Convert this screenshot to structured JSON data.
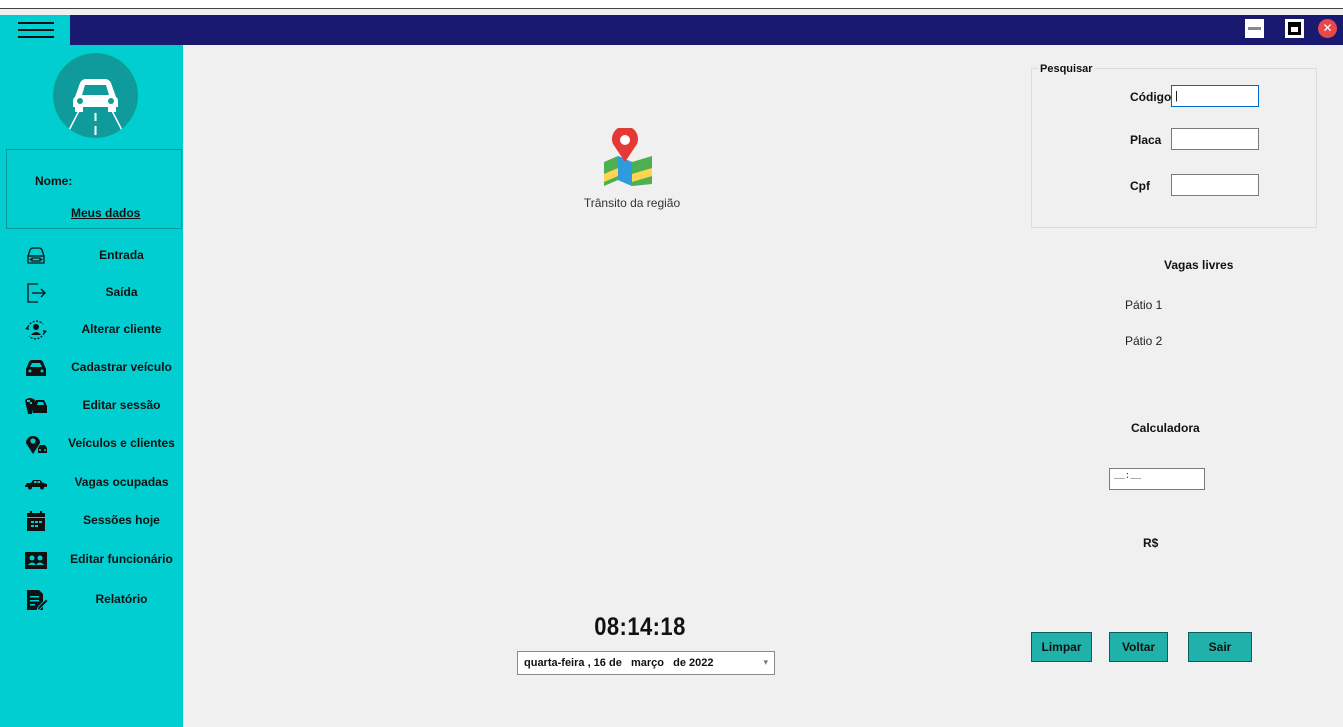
{
  "window": {
    "controls": [
      "minimize-icon",
      "maximize-icon",
      "close-icon"
    ],
    "close_glyph": "✕",
    "colors": {
      "titlebar": "#191970",
      "sidebar": "#00CED1",
      "button": "#20b2aa",
      "close": "#e9484b"
    }
  },
  "sidebar": {
    "nome_label": "Nome:",
    "meus_dados": "Meus dados",
    "items": [
      {
        "label": "Entrada",
        "icon": "car-front-outline-icon"
      },
      {
        "label": "Saída",
        "icon": "exit-icon"
      },
      {
        "label": "Alterar cliente",
        "icon": "user-refresh-icon"
      },
      {
        "label": "Cadastrar veículo",
        "icon": "car-add-icon"
      },
      {
        "label": "Editar sessão",
        "icon": "taxi-edit-icon"
      },
      {
        "label": "Veículos e clientes",
        "icon": "location-car-icon"
      },
      {
        "label": "Vagas ocupadas",
        "icon": "car-side-icon"
      },
      {
        "label": "Sessões hoje",
        "icon": "calendar-icon"
      },
      {
        "label": "Editar funcionário",
        "icon": "employee-icon"
      },
      {
        "label": "Relatório",
        "icon": "report-edit-icon"
      }
    ]
  },
  "main": {
    "map_label": "Trânsito da região",
    "clock": "08:14:18",
    "date": "quarta-feira , 16 de   março   de 2022",
    "date_dropdown": "▾"
  },
  "search": {
    "title": "Pesquisar",
    "codigo_label": "Código",
    "codigo_value": "|",
    "placa_label": "Placa",
    "cpf_label": "Cpf"
  },
  "vagas": {
    "title": "Vagas livres",
    "patio1": "Pátio 1",
    "patio2": "Pátio 2"
  },
  "calculadora": {
    "title": "Calculadora",
    "mask": "__:__",
    "currency": "R$"
  },
  "buttons": {
    "limpar": "Limpar",
    "voltar": "Voltar",
    "sair": "Sair"
  }
}
